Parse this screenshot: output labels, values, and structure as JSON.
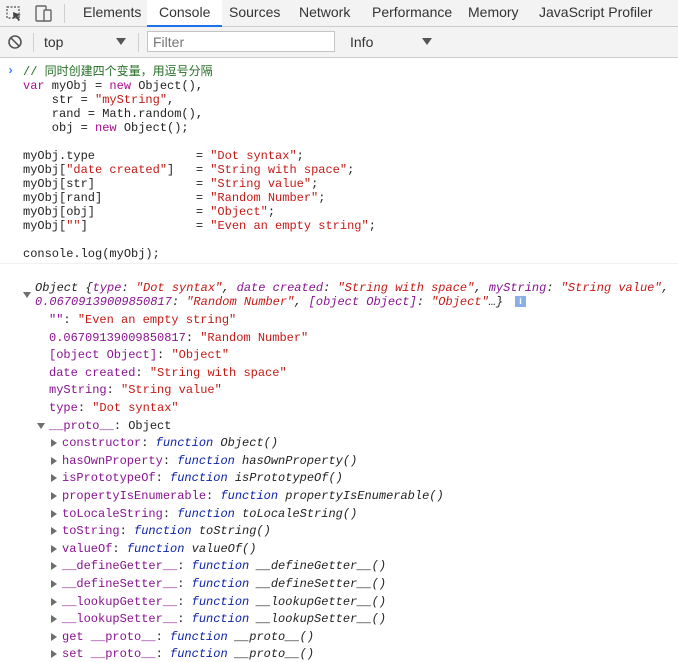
{
  "tabs": [
    "Elements",
    "Console",
    "Sources",
    "Network",
    "Performance",
    "Memory",
    "JavaScript Profiler"
  ],
  "toolbar": {
    "context": "top",
    "filter_placeholder": "Filter",
    "level": "Info"
  },
  "code": [
    [
      [
        "cmt",
        "// 同时创建四个变量，用逗号分隔"
      ]
    ],
    [
      [
        "kw",
        "var"
      ],
      [
        "t",
        " myObj = "
      ],
      [
        "kw",
        "new"
      ],
      [
        "t",
        " Object(),"
      ]
    ],
    [
      [
        "t",
        "    str = "
      ],
      [
        "str",
        "\"myString\""
      ],
      [
        "t",
        ","
      ]
    ],
    [
      [
        "t",
        "    rand = Math.random(),"
      ]
    ],
    [
      [
        "t",
        "    obj = "
      ],
      [
        "kw",
        "new"
      ],
      [
        "t",
        " Object();"
      ]
    ],
    [
      [
        "t",
        ""
      ]
    ],
    [
      [
        "t",
        "myObj.type              = "
      ],
      [
        "str",
        "\"Dot syntax\""
      ],
      [
        "t",
        ";"
      ]
    ],
    [
      [
        "t",
        "myObj["
      ],
      [
        "str",
        "\"date created\""
      ],
      [
        "t",
        "]   = "
      ],
      [
        "str",
        "\"String with space\""
      ],
      [
        "t",
        ";"
      ]
    ],
    [
      [
        "t",
        "myObj[str]              = "
      ],
      [
        "str",
        "\"String value\""
      ],
      [
        "t",
        ";"
      ]
    ],
    [
      [
        "t",
        "myObj[rand]             = "
      ],
      [
        "str",
        "\"Random Number\""
      ],
      [
        "t",
        ";"
      ]
    ],
    [
      [
        "t",
        "myObj[obj]              = "
      ],
      [
        "str",
        "\"Object\""
      ],
      [
        "t",
        ";"
      ]
    ],
    [
      [
        "t",
        "myObj["
      ],
      [
        "str",
        "\"\""
      ],
      [
        "t",
        "]               = "
      ],
      [
        "str",
        "\"Even an empty string\""
      ],
      [
        "t",
        ";"
      ]
    ],
    [
      [
        "t",
        ""
      ]
    ],
    [
      [
        "t",
        "console.log(myObj);"
      ]
    ]
  ],
  "output": {
    "summary_line1": [
      [
        "it",
        "Object {"
      ],
      [
        "key it",
        "type"
      ],
      [
        "it",
        ": "
      ],
      [
        "v-str it",
        "\"Dot syntax\""
      ],
      [
        "it",
        ", "
      ],
      [
        "key it",
        "date created"
      ],
      [
        "it",
        ": "
      ],
      [
        "v-str it",
        "\"String with space\""
      ],
      [
        "it",
        ", "
      ],
      [
        "key it",
        "myString"
      ],
      [
        "it",
        ": "
      ],
      [
        "v-str it",
        "\"String value\""
      ],
      [
        "it",
        ","
      ]
    ],
    "summary_line2": [
      [
        "key it",
        "0.06709139009850817"
      ],
      [
        "it",
        ": "
      ],
      [
        "v-str it",
        "\"Random Number\""
      ],
      [
        "it",
        ", "
      ],
      [
        "key it",
        "[object Object]"
      ],
      [
        "it",
        ": "
      ],
      [
        "v-str it",
        "\"Object\""
      ],
      [
        "it",
        "…}"
      ]
    ],
    "info_badge": "i",
    "props": [
      [
        [
          "key",
          "\"\""
        ],
        [
          "t",
          ": "
        ],
        [
          "v-str",
          "\"Even an empty string\""
        ]
      ],
      [
        [
          "key",
          "0.06709139009850817"
        ],
        [
          "t",
          ": "
        ],
        [
          "v-str",
          "\"Random Number\""
        ]
      ],
      [
        [
          "key",
          "[object Object]"
        ],
        [
          "t",
          ": "
        ],
        [
          "v-str",
          "\"Object\""
        ]
      ],
      [
        [
          "key",
          "date created"
        ],
        [
          "t",
          ": "
        ],
        [
          "v-str",
          "\"String with space\""
        ]
      ],
      [
        [
          "key",
          "myString"
        ],
        [
          "t",
          ": "
        ],
        [
          "v-str",
          "\"String value\""
        ]
      ],
      [
        [
          "key",
          "type"
        ],
        [
          "t",
          ": "
        ],
        [
          "v-str",
          "\"Dot syntax\""
        ]
      ]
    ],
    "proto_line": [
      [
        "key",
        "__proto__"
      ],
      [
        "t",
        ": Object"
      ]
    ],
    "proto_members": [
      [
        [
          "key",
          "constructor"
        ],
        [
          "t",
          ": "
        ],
        [
          "kw2 it",
          "function"
        ],
        [
          "it",
          " Object()"
        ]
      ],
      [
        [
          "key",
          "hasOwnProperty"
        ],
        [
          "t",
          ": "
        ],
        [
          "kw2 it",
          "function"
        ],
        [
          "it",
          " hasOwnProperty()"
        ]
      ],
      [
        [
          "key",
          "isPrototypeOf"
        ],
        [
          "t",
          ": "
        ],
        [
          "kw2 it",
          "function"
        ],
        [
          "it",
          " isPrototypeOf()"
        ]
      ],
      [
        [
          "key",
          "propertyIsEnumerable"
        ],
        [
          "t",
          ": "
        ],
        [
          "kw2 it",
          "function"
        ],
        [
          "it",
          " propertyIsEnumerable()"
        ]
      ],
      [
        [
          "key",
          "toLocaleString"
        ],
        [
          "t",
          ": "
        ],
        [
          "kw2 it",
          "function"
        ],
        [
          "it",
          " toLocaleString()"
        ]
      ],
      [
        [
          "key",
          "toString"
        ],
        [
          "t",
          ": "
        ],
        [
          "kw2 it",
          "function"
        ],
        [
          "it",
          " toString()"
        ]
      ],
      [
        [
          "key",
          "valueOf"
        ],
        [
          "t",
          ": "
        ],
        [
          "kw2 it",
          "function"
        ],
        [
          "it",
          " valueOf()"
        ]
      ],
      [
        [
          "key",
          "__defineGetter__"
        ],
        [
          "t",
          ": "
        ],
        [
          "kw2 it",
          "function"
        ],
        [
          "it",
          " __defineGetter__()"
        ]
      ],
      [
        [
          "key",
          "__defineSetter__"
        ],
        [
          "t",
          ": "
        ],
        [
          "kw2 it",
          "function"
        ],
        [
          "it",
          " __defineSetter__()"
        ]
      ],
      [
        [
          "key",
          "__lookupGetter__"
        ],
        [
          "t",
          ": "
        ],
        [
          "kw2 it",
          "function"
        ],
        [
          "it",
          " __lookupGetter__()"
        ]
      ],
      [
        [
          "key",
          "__lookupSetter__"
        ],
        [
          "t",
          ": "
        ],
        [
          "kw2 it",
          "function"
        ],
        [
          "it",
          " __lookupSetter__()"
        ]
      ],
      [
        [
          "key",
          "get __proto__"
        ],
        [
          "t",
          ": "
        ],
        [
          "kw2 it",
          "function"
        ],
        [
          "it",
          " __proto__()"
        ]
      ],
      [
        [
          "key",
          "set __proto__"
        ],
        [
          "t",
          ": "
        ],
        [
          "kw2 it",
          "function"
        ],
        [
          "it",
          " __proto__()"
        ]
      ]
    ]
  }
}
